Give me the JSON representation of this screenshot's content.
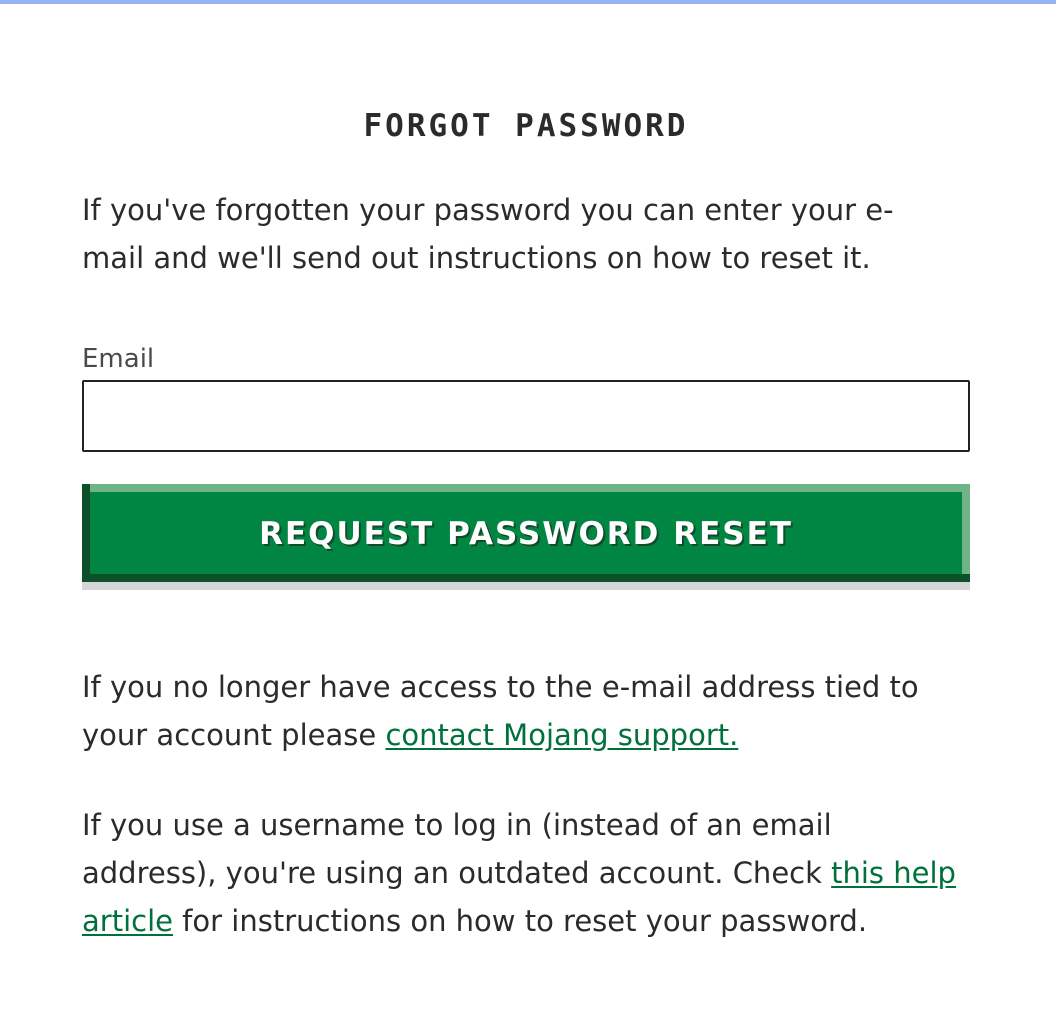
{
  "title": "FORGOT PASSWORD",
  "intro": "If you've forgotten your password you can enter your e-mail and we'll send out instructions on how to reset it.",
  "email_field": {
    "label": "Email",
    "value": "",
    "placeholder": ""
  },
  "submit_button": {
    "label": "REQUEST PASSWORD RESET"
  },
  "no_access": {
    "text_before": "If you no longer have access to the e-mail address tied to your account please ",
    "link": "contact Mojang support."
  },
  "username_notice": {
    "text_before": "If you use a username to log in (instead of an email address), you're using an outdated account. Check ",
    "link": "this help article",
    "text_after": " for instructions on how to reset your password."
  },
  "colors": {
    "accent": "#008542",
    "link": "#00703c",
    "top_bar": "#93b4f5"
  }
}
